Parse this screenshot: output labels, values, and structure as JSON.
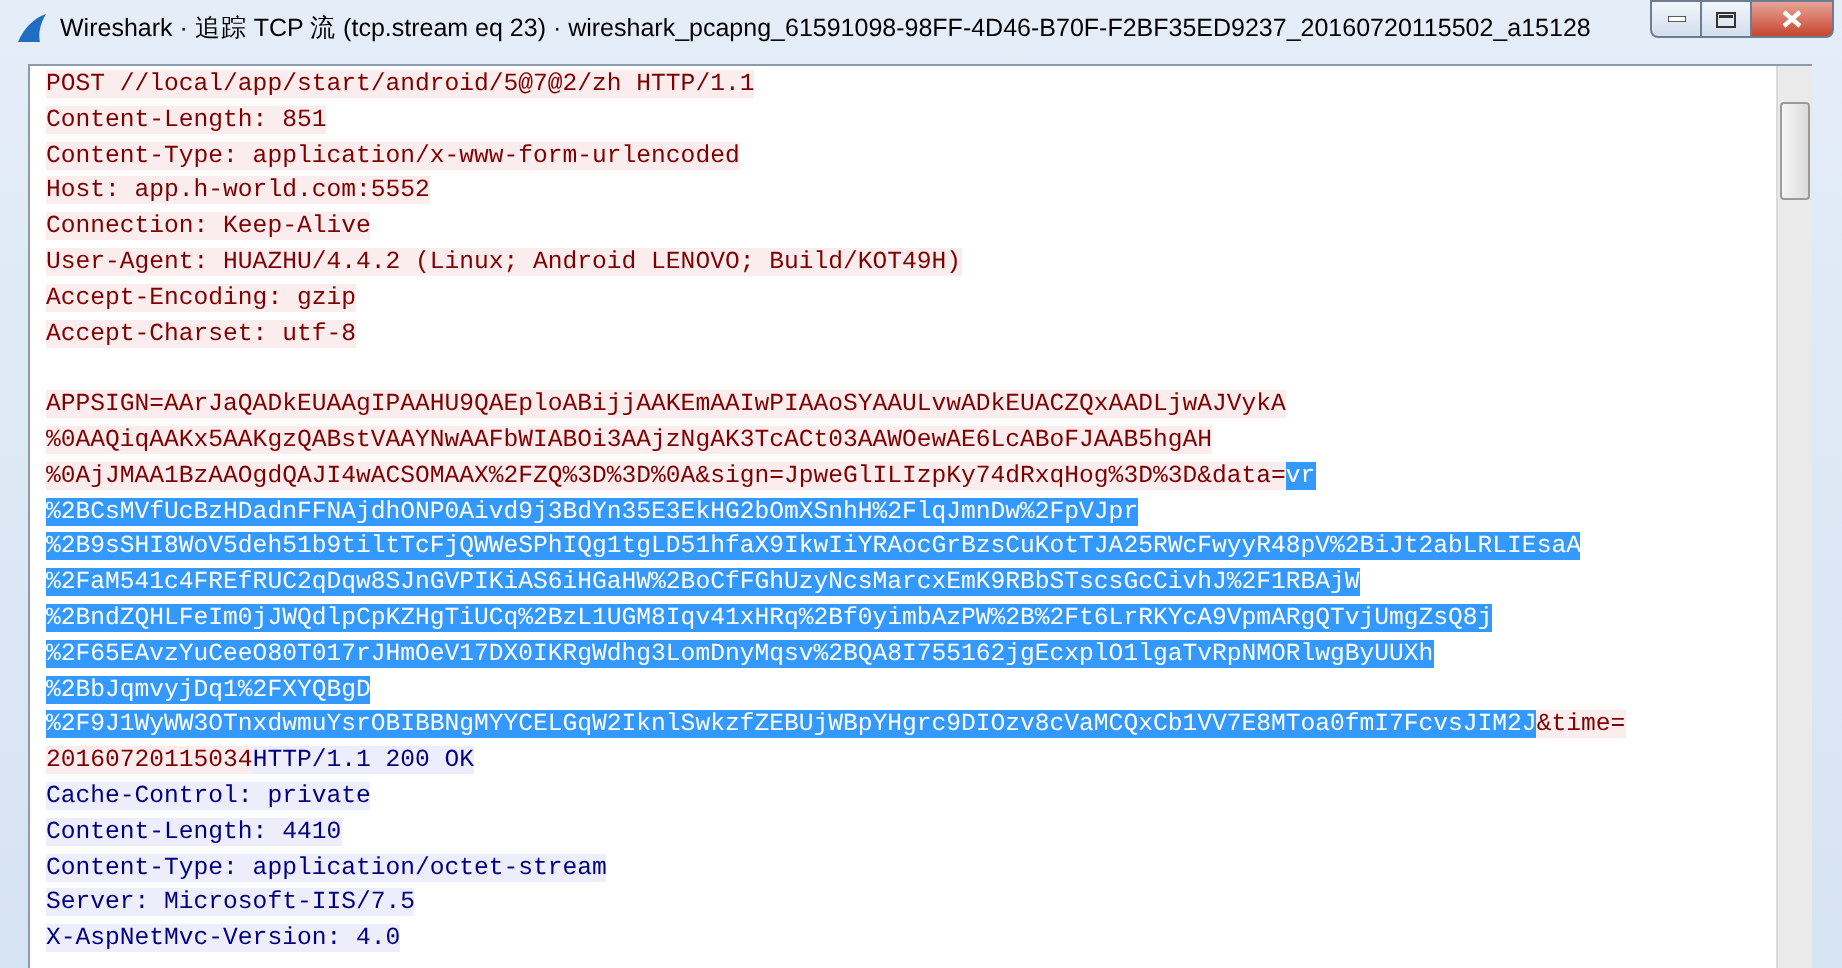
{
  "window": {
    "title": "Wireshark · 追踪 TCP 流 (tcp.stream eq 23) · wireshark_pcapng_61591098-98FF-4D46-B70F-F2BF35ED9237_20160720115502_a15128"
  },
  "stream": {
    "lines": [
      {
        "segments": [
          {
            "kind": "client",
            "text": "POST //local/app/start/android/5@7@2/zh HTTP/1.1"
          }
        ]
      },
      {
        "segments": [
          {
            "kind": "client",
            "text": "Content-Length: 851"
          }
        ]
      },
      {
        "segments": [
          {
            "kind": "client",
            "text": "Content-Type: application/x-www-form-urlencoded"
          }
        ]
      },
      {
        "segments": [
          {
            "kind": "client",
            "text": "Host: app.h-world.com:5552"
          }
        ]
      },
      {
        "segments": [
          {
            "kind": "client",
            "text": "Connection: Keep-Alive"
          }
        ]
      },
      {
        "segments": [
          {
            "kind": "client",
            "text": "User-Agent: HUAZHU/4.4.2 (Linux; Android LENOVO; Build/KOT49H)"
          }
        ]
      },
      {
        "segments": [
          {
            "kind": "client",
            "text": "Accept-Encoding: gzip"
          }
        ]
      },
      {
        "segments": [
          {
            "kind": "client",
            "text": "Accept-Charset: utf-8"
          }
        ]
      },
      {
        "blank_line_before": true,
        "segments": [
          {
            "kind": "client",
            "text": "APPSIGN=AArJaQADkEUAAgIPAAHU9QAEploABijjAAKEmAAIwPIAAoSYAAULvwADkEUACZQxAADLjwAJVykA"
          }
        ]
      },
      {
        "segments": [
          {
            "kind": "client",
            "text": "%0AAQiqAAKx5AAKgzQABstVAAYNwAAFbWIABOi3AAjzNgAK3TcACt03AAWOewAE6LcABoFJAAB5hgAH"
          }
        ]
      },
      {
        "segments": [
          {
            "kind": "client",
            "text": "%0AjJMAA1BzAAOgdQAJI4wACSOMAAX%2FZQ%3D%3D%0A&sign=JpweGlILIzpKy74dRxqHog%3D%3D&data="
          },
          {
            "kind": "selected",
            "text": "vr"
          }
        ]
      },
      {
        "segments": [
          {
            "kind": "selected",
            "text": "%2BCsMVfUcBzHDadnFFNAjdhONP0Aivd9j3BdYn35E3EkHG2bOmXSnhH%2FlqJmnDw%2FpVJpr"
          }
        ]
      },
      {
        "segments": [
          {
            "kind": "selected",
            "text": "%2B9sSHI8WoV5deh51b9tiltTcFjQWWeSPhIQg1tgLD51hfaX9IkwIiYRAocGrBzsCuKotTJA25RWcFwyyR48pV%2BiJt2abLRLIEsaA"
          }
        ]
      },
      {
        "segments": [
          {
            "kind": "selected",
            "text": "%2FaM541c4FREfRUC2qDqw8SJnGVPIKiAS6iHGaHW%2BoCfFGhUzyNcsMarcxEmK9RBbSTscsGcCivhJ%2F1RBAjW"
          }
        ]
      },
      {
        "segments": [
          {
            "kind": "selected",
            "text": "%2BndZQHLFeIm0jJWQdlpCpKZHgTiUCq%2BzL1UGM8Iqv41xHRq%2Bf0yimbAzPW%2B%2Ft6LrRKYcA9VpmARgQTvjUmgZsQ8j"
          }
        ]
      },
      {
        "segments": [
          {
            "kind": "selected",
            "text": "%2F65EAvzYuCeeO80T017rJHmOeV17DX0IKRgWdhg3LomDnyMqsv%2BQA8I755162jgEcxplO1lgaTvRpNMORlwgByUUXh"
          }
        ]
      },
      {
        "segments": [
          {
            "kind": "selected",
            "text": "%2BbJqmvyjDq1%2FXYQBgD"
          }
        ]
      },
      {
        "segments": [
          {
            "kind": "selected",
            "text": "%2F9J1WyWW3OTnxdwmuYsrOBIBBNgMYYCELGqW2IknlSwkzfZEBUjWBpYHgrc9DIOzv8cVaMCQxCb1VV7E8MToa0fmI7FcvsJIM2J"
          },
          {
            "kind": "client",
            "text": "&time="
          }
        ]
      },
      {
        "segments": [
          {
            "kind": "client",
            "text": "20160720115034"
          },
          {
            "kind": "server",
            "text": "HTTP/1.1 200 OK"
          }
        ]
      },
      {
        "segments": [
          {
            "kind": "server",
            "text": "Cache-Control: private"
          }
        ]
      },
      {
        "segments": [
          {
            "kind": "server",
            "text": "Content-Length: 4410"
          }
        ]
      },
      {
        "segments": [
          {
            "kind": "server",
            "text": "Content-Type: application/octet-stream"
          }
        ]
      },
      {
        "segments": [
          {
            "kind": "server",
            "text": "Server: Microsoft-IIS/7.5"
          }
        ]
      },
      {
        "segments": [
          {
            "kind": "server",
            "text": "X-AspNetMvc-Version: 4.0"
          }
        ]
      }
    ]
  }
}
